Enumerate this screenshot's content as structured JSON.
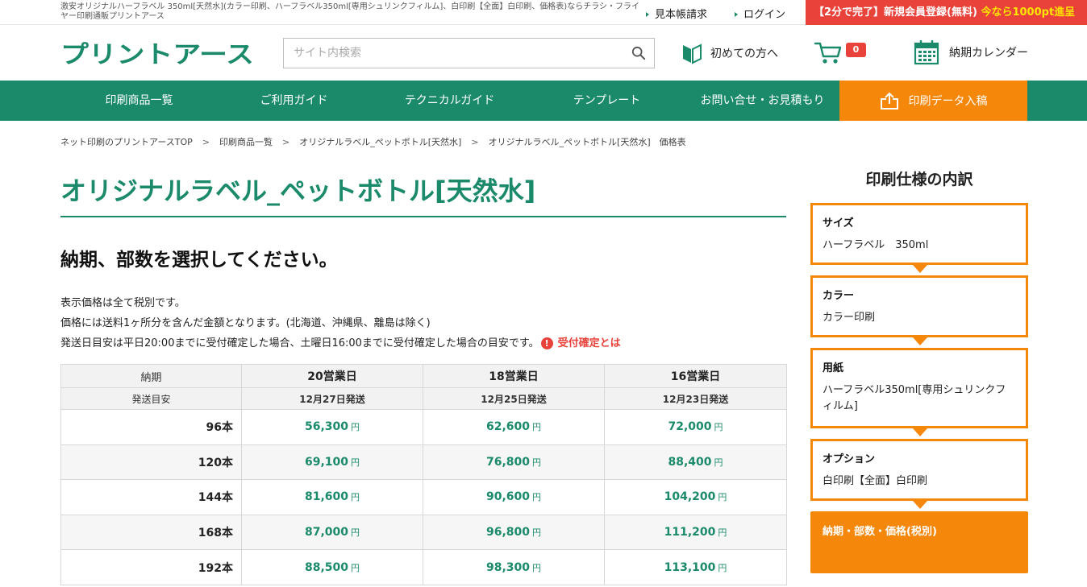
{
  "topbar": {
    "seo_text": "激安オリジナルハーフラベル 350ml[天然水](カラー印刷、ハーフラベル350ml[専用シュリンクフィルム]、白印刷【全面】白印刷、価格表)ならチラシ・フライヤー印刷通販プリントアース",
    "catalog_link": "見本帳請求",
    "login_link": "ログイン",
    "signup_banner": {
      "main": "【2分で完了】新規会員登録(無料)",
      "highlight": "今なら1000pt進呈"
    }
  },
  "header": {
    "logo_text": "プリントアース",
    "search_placeholder": "サイト内検索",
    "first_time_label": "初めての方へ",
    "cart_count": "0",
    "calendar_label": "納期カレンダー"
  },
  "nav": {
    "items": [
      "印刷商品一覧",
      "ご利用ガイド",
      "テクニカルガイド",
      "テンプレート",
      "お問い合せ・お見積もり"
    ],
    "upload_label": "印刷データ入稿"
  },
  "breadcrumb": [
    "ネット印刷のプリントアースTOP",
    "印刷商品一覧",
    "オリジナルラベル_ペットボトル[天然水]",
    "オリジナルラベル_ペットボトル[天然水]　価格表"
  ],
  "page": {
    "title": "オリジナルラベル_ペットボトル[天然水]",
    "subheading": "納期、部数を選択してください。",
    "notes": [
      "表示価格は全て税別です。",
      "価格には送料1ヶ所分を含んだ金額となります。(北海道、沖縄県、離島は除く)",
      "発送日目安は平日20:00までに受付確定した場合、土曜日16:00までに受付確定した場合の目安です。"
    ],
    "warn_icon": "!",
    "warn_link": "受付確定とは"
  },
  "price_table": {
    "row_header_1": "納期",
    "row_header_2": "発送目安",
    "columns": [
      {
        "days": "20営業日",
        "ship": "12月27日発送"
      },
      {
        "days": "18営業日",
        "ship": "12月25日発送"
      },
      {
        "days": "16営業日",
        "ship": "12月23日発送"
      }
    ],
    "currency": "円",
    "rows": [
      {
        "qty": "96本",
        "prices": [
          "56,300",
          "62,600",
          "72,000"
        ]
      },
      {
        "qty": "120本",
        "prices": [
          "69,100",
          "76,800",
          "88,400"
        ]
      },
      {
        "qty": "144本",
        "prices": [
          "81,600",
          "90,600",
          "104,200"
        ]
      },
      {
        "qty": "168本",
        "prices": [
          "87,000",
          "96,800",
          "111,200"
        ]
      },
      {
        "qty": "192本",
        "prices": [
          "88,500",
          "98,300",
          "113,100"
        ]
      }
    ]
  },
  "sidebar": {
    "title": "印刷仕様の内訳",
    "specs": [
      {
        "label": "サイズ",
        "value": "ハーフラベル　350ml"
      },
      {
        "label": "カラー",
        "value": "カラー印刷"
      },
      {
        "label": "用紙",
        "value": "ハーフラベル350ml[専用シュリンクフィルム]"
      },
      {
        "label": "オプション",
        "value": "白印刷【全面】白印刷"
      }
    ],
    "active_step": "納期・部数・価格(税別)"
  },
  "colors": {
    "brand_green": "#1b8a6b",
    "accent_orange": "#f5870a",
    "alert_red": "#e8423a"
  }
}
